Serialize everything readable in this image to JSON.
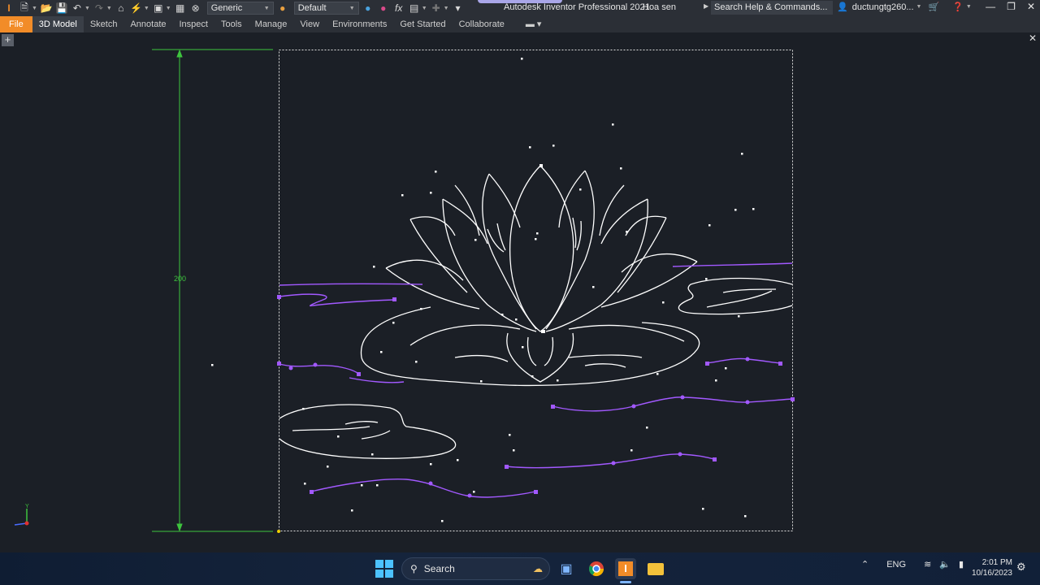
{
  "titlebar": {
    "material": "Generic",
    "appearance": "Default",
    "app_title": "Autodesk Inventor Professional 2021",
    "doc_title": "Hoa sen",
    "search_placeholder": "Search Help & Commands...",
    "user": "ductungtg260..."
  },
  "ribbon": {
    "tabs": [
      "File",
      "3D Model",
      "Sketch",
      "Annotate",
      "Inspect",
      "Tools",
      "Manage",
      "View",
      "Environments",
      "Get Started",
      "Collaborate"
    ]
  },
  "canvas": {
    "dimension_value": "200"
  },
  "taskbar": {
    "search_label": "Search",
    "language": "ENG",
    "time": "2:01 PM",
    "date": "10/16/2023"
  },
  "colors": {
    "file_tab": "#f28c28",
    "sketch_line": "#ffffff",
    "spline": "#a259ff",
    "dimension": "#3ec43e"
  }
}
